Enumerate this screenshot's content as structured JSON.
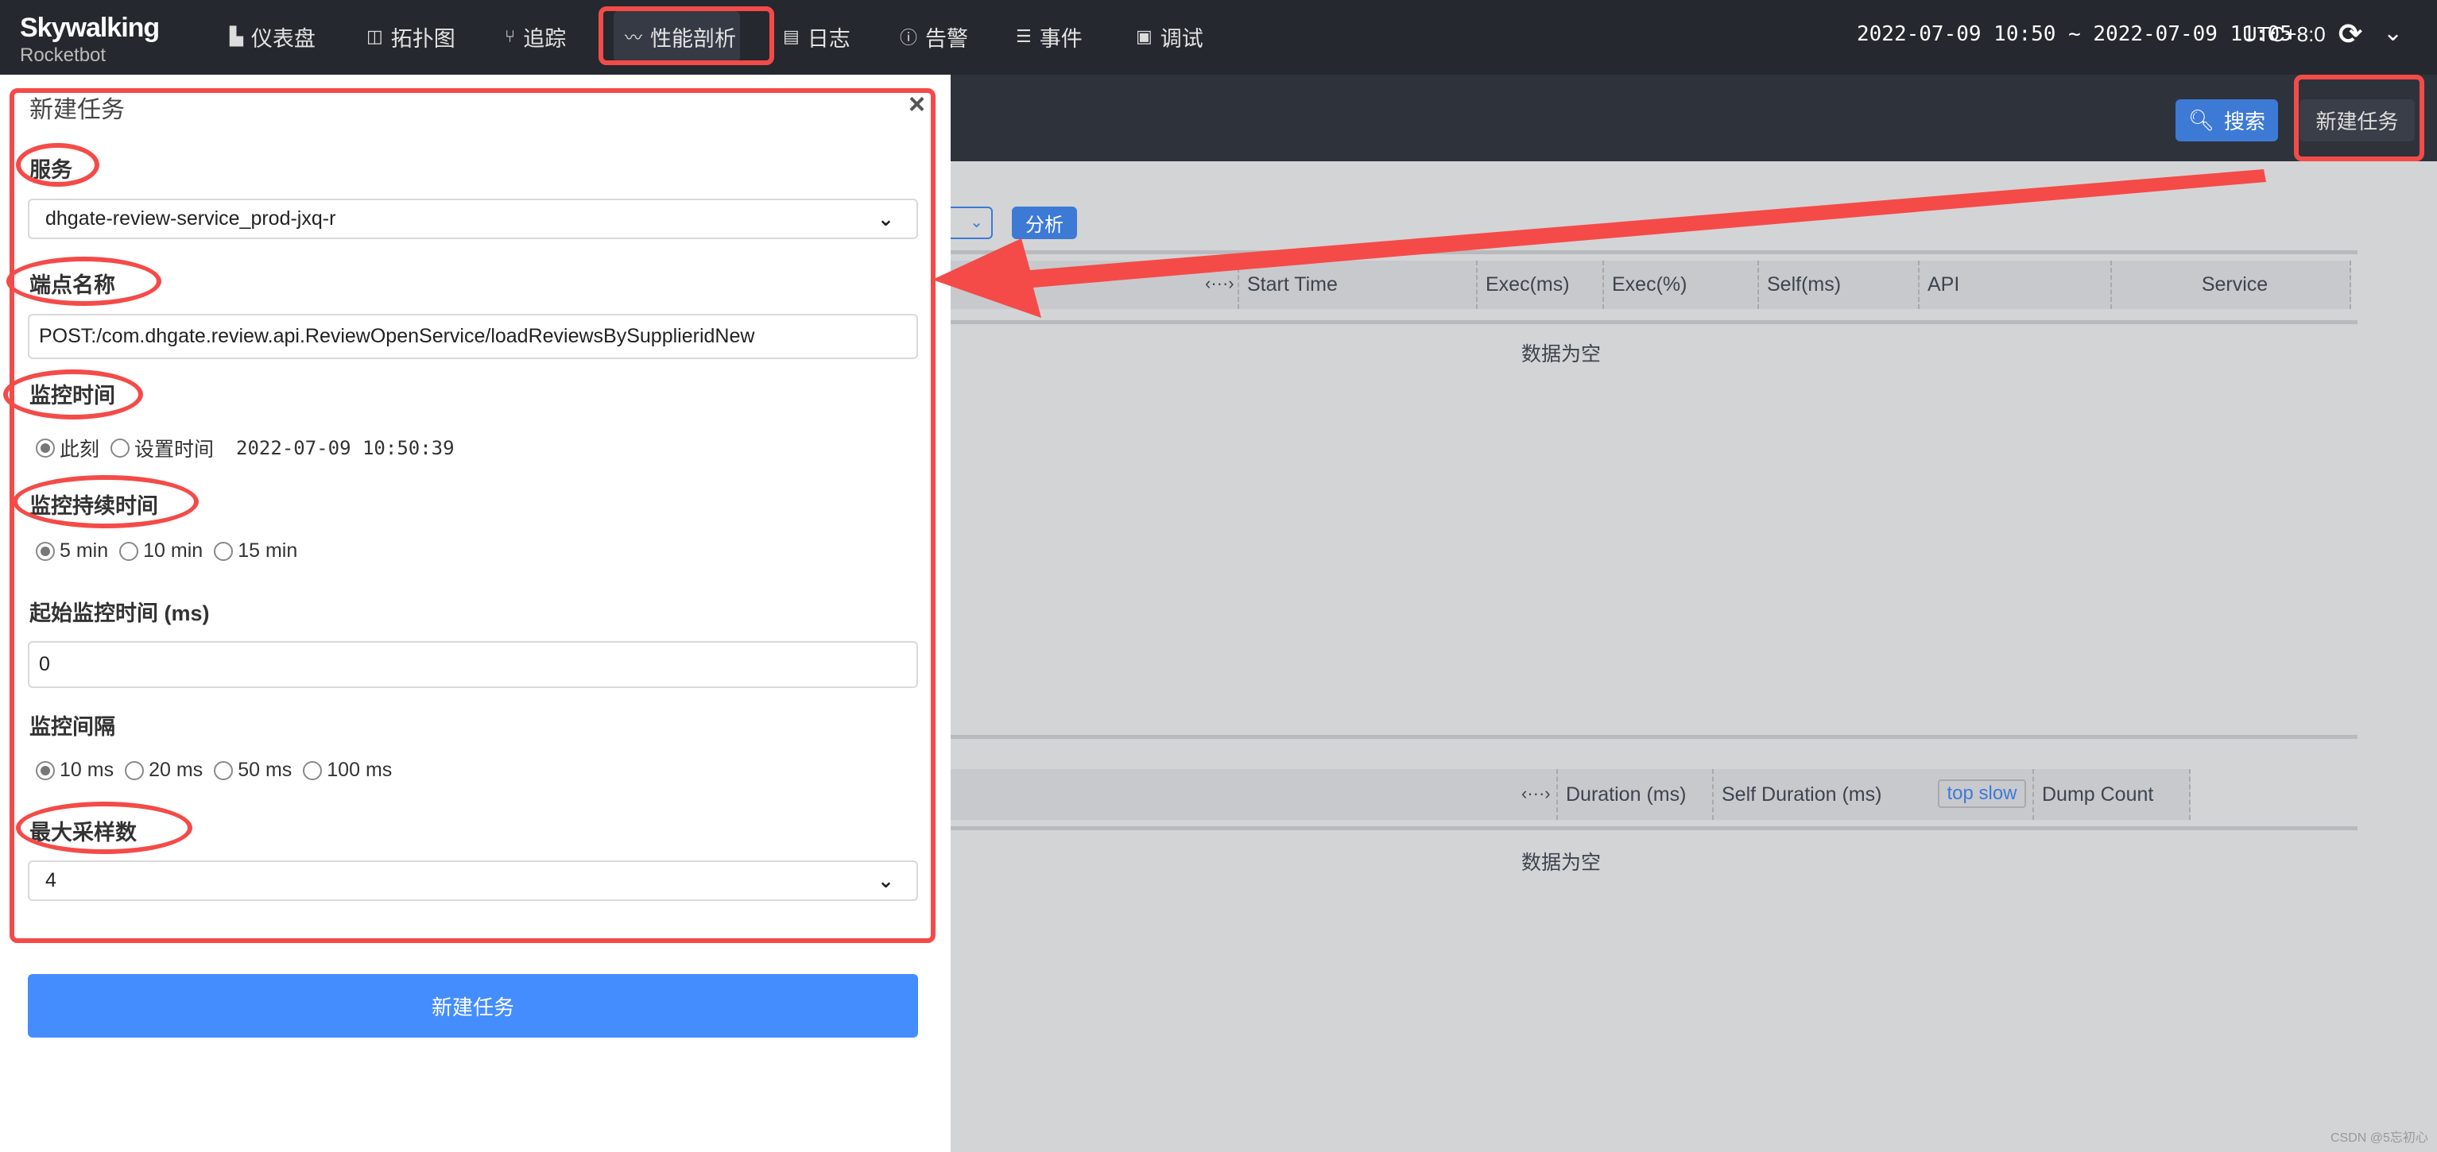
{
  "nav": {
    "logo_top": "Skywalking",
    "logo_bottom": "Rocketbot",
    "items": [
      {
        "label": "仪表盘",
        "icon": "dashboard-icon"
      },
      {
        "label": "拓扑图",
        "icon": "topology-icon"
      },
      {
        "label": "追踪",
        "icon": "trace-icon"
      },
      {
        "label": "性能剖析",
        "icon": "profile-icon",
        "active": true
      },
      {
        "label": "日志",
        "icon": "log-icon"
      },
      {
        "label": "告警",
        "icon": "alarm-icon"
      },
      {
        "label": "事件",
        "icon": "event-icon"
      },
      {
        "label": "调试",
        "icon": "debug-icon"
      }
    ],
    "time_range": "2022-07-09 10:50 ~ 2022-07-09 11:05",
    "timezone": "UTC+8:0"
  },
  "toolbar": {
    "search_label": "搜索",
    "new_task_label": "新建任务"
  },
  "main": {
    "analyze_label": "分析",
    "segment_table": {
      "headers": [
        "Start Time",
        "Exec(ms)",
        "Exec(%)",
        "Self(ms)",
        "API",
        "Service"
      ],
      "toggle": "‹···›",
      "empty": "数据为空"
    },
    "stack_table": {
      "headers": [
        "Duration (ms)",
        "Self Duration (ms)",
        "Dump Count"
      ],
      "toggle": "‹···›",
      "top_slow": "top slow",
      "empty": "数据为空"
    }
  },
  "panel": {
    "title": "新建任务",
    "close": "×",
    "service_label": "服务",
    "service_value": "dhgate-review-service_prod-jxq-r",
    "endpoint_label": "端点名称",
    "endpoint_value": "POST:/com.dhgate.review.api.ReviewOpenService/loadReviewsBySupplieridNew",
    "monitor_time_label": "监控时间",
    "monitor_time_options": [
      "此刻",
      "设置时间"
    ],
    "monitor_time_value": "2022-07-09 10:50:39",
    "duration_label": "监控持续时间",
    "duration_options": [
      "5 min",
      "10 min",
      "15 min"
    ],
    "start_label": "起始监控时间 (ms)",
    "start_value": "0",
    "interval_label": "监控间隔",
    "interval_options": [
      "10 ms",
      "20 ms",
      "50 ms",
      "100 ms"
    ],
    "max_sample_label": "最大采样数",
    "max_sample_value": "4",
    "submit_label": "新建任务"
  },
  "watermark": "CSDN @5忘初心",
  "colors": {
    "annotation": "#f44b48",
    "primary": "#3d7ad6",
    "submit": "#448dfe"
  }
}
